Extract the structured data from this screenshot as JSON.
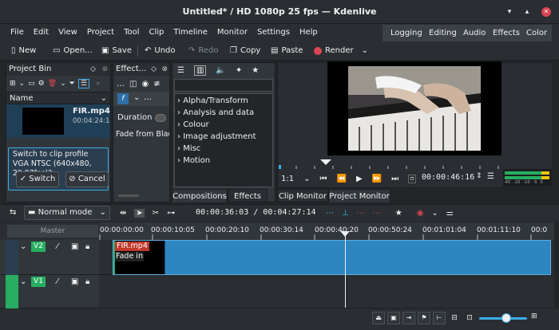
{
  "window": {
    "title": "Untitled* / HD 1080p 25 fps — Kdenlive",
    "minimize": "▾",
    "maximize": "▴",
    "close": "✕"
  },
  "menu": [
    "File",
    "Edit",
    "View",
    "Project",
    "Tool",
    "Clip",
    "Timeline",
    "Monitor",
    "Settings",
    "Help"
  ],
  "workspaces": [
    "Logging",
    "Editing",
    "Audio",
    "Effects",
    "Color"
  ],
  "toolbar": {
    "new": "New",
    "open": "Open...",
    "save": "Save",
    "undo": "Undo",
    "redo": "Redo",
    "copy": "Copy",
    "paste": "Paste",
    "render": "Render"
  },
  "project_bin": {
    "title": "Project Bin",
    "column": "Name",
    "clip_name": "FIR.mp4",
    "clip_duration": "00:04:24:1",
    "profile_message": "Switch to clip profile VGA NTSC (640x480, 29.97fps)?",
    "switch_label": "Switch",
    "cancel_label": "Cancel"
  },
  "effects_panel": {
    "title": "Effect...",
    "duration_label": "Duration",
    "fade_label": "Fade from Black"
  },
  "effects_list": {
    "items": [
      "Alpha/Transform",
      "Analysis and data",
      "Colour",
      "Image adjustment",
      "Misc",
      "Motion"
    ],
    "tab_compositions": "Compositions",
    "tab_effects": "Effects"
  },
  "monitor": {
    "zoom": "1:1",
    "timecode": "00:00:46:16",
    "tab_clip": "Clip Monitor",
    "tab_project": "Project Monitor",
    "levels": [
      "-45",
      "-20",
      "-10",
      "-5",
      "0"
    ]
  },
  "timeline": {
    "mode": "Normal mode",
    "position": "00:00:36:03",
    "duration": "00:04:27:14",
    "master": "Master",
    "ruler": [
      "00:00:00:00",
      "00:00:10:05",
      "00:00:20:10",
      "00:00:30:14",
      "00:00:40:20",
      "00:00:50:24",
      "00:01:01:04",
      "00:01:11:10",
      "00:0"
    ],
    "tracks": [
      {
        "name": "V2"
      },
      {
        "name": "V1"
      }
    ],
    "clip_name": "FIR.mp4",
    "clip_effect": "Fade in"
  },
  "colors": {
    "accent": "#3daee9",
    "clip": "#2e86c1",
    "track_green": "#27ae60",
    "label_red": "#c0392b"
  }
}
